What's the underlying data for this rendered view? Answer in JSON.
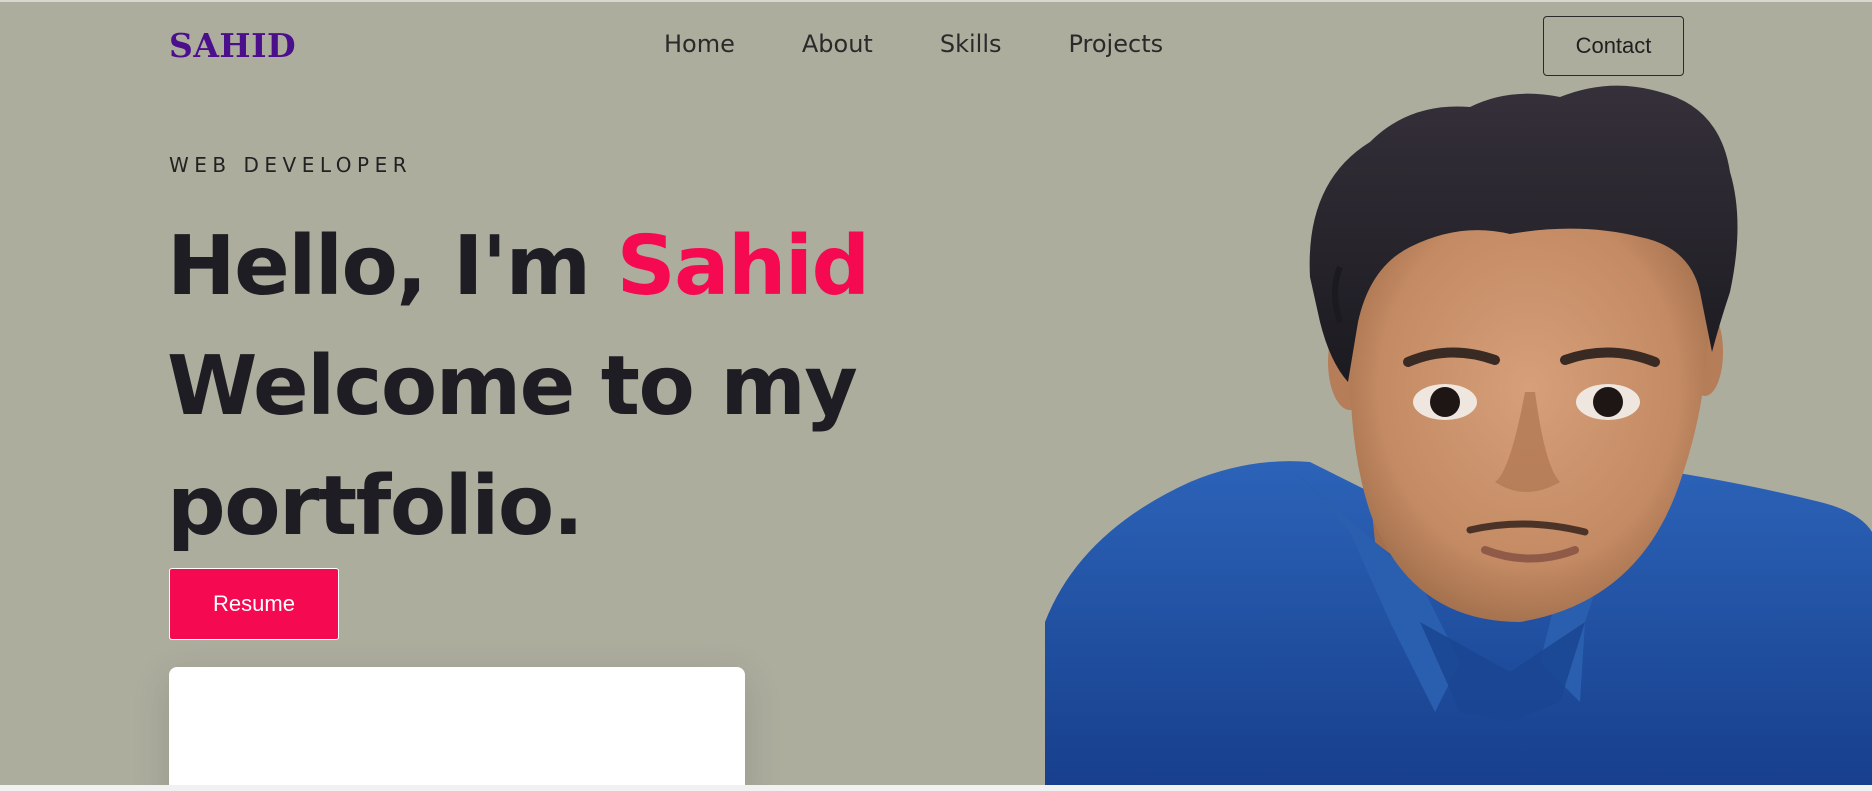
{
  "nav": {
    "logo": "SAHID",
    "links": [
      "Home",
      "About",
      "Skills",
      "Projects"
    ],
    "contact_label": "Contact"
  },
  "hero": {
    "eyebrow": "WEB DEVELOPER",
    "greeting": "Hello, I'm ",
    "name": "Sahid",
    "line2": "Welcome to my",
    "line3": "portfolio.",
    "resume_label": "Resume"
  },
  "colors": {
    "background": "#adad9e",
    "logo": "#4b0f8c",
    "accent": "#f50a52",
    "heading": "#1f1d24",
    "shirt": "#1d4fa3"
  },
  "image": {
    "subject": "portrait-photo"
  }
}
